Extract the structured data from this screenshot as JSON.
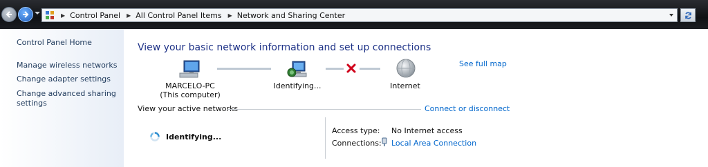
{
  "address_bar": {
    "breadcrumbs": [
      "Control Panel",
      "All Control Panel Items",
      "Network and Sharing Center"
    ],
    "icon": "control-panel-icon"
  },
  "left_pane": {
    "home": "Control Panel Home",
    "links": [
      "Manage wireless networks",
      "Change adapter settings",
      "Change advanced sharing",
      "settings"
    ]
  },
  "main": {
    "title": "View your basic network information and set up connections",
    "see_full_map": "See full map",
    "map": {
      "computer": {
        "name": "MARCELO-PC",
        "sub": "(This computer)",
        "icon": "computer-icon"
      },
      "network": {
        "name": "Identifying...",
        "icon": "network-identifying-icon"
      },
      "internet": {
        "name": "Internet",
        "icon": "globe-icon"
      },
      "broken_link_icon": "red-x-icon"
    },
    "active_networks_label": "View your active networks",
    "connect_link": "Connect or disconnect",
    "active_network": {
      "name": "Identifying...",
      "icon": "busy-spinner-icon",
      "access_type_label": "Access type:",
      "access_type_value": "No Internet access",
      "connections_label": "Connections:",
      "connections_value": "Local Area Connection",
      "connection_icon": "ethernet-plug-icon"
    }
  },
  "colors": {
    "link": "#0066cc",
    "title": "#1e3287",
    "error": "#d0021b"
  }
}
